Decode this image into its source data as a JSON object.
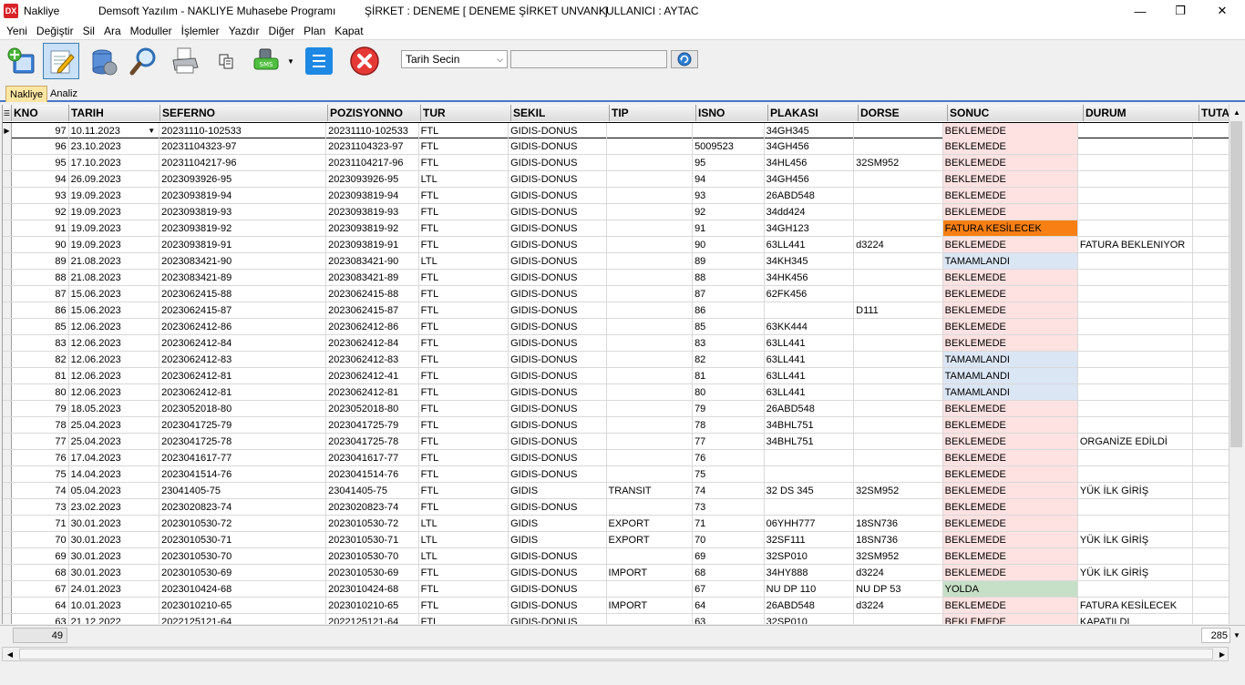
{
  "titlebar": {
    "app_name": "Nakliye",
    "company_name": "Demsoft Yazılım - NAKLIYE Muhasebe Programı",
    "firm": "ŞİRKET : DENEME [ DENEME ŞİRKET UNVANI ]",
    "user": "KULLANICI : AYTAC",
    "minimize": "—",
    "maximize": "❐",
    "close": "✕"
  },
  "menu": [
    "Yeni",
    "Değiştir",
    "Sil",
    "Ara",
    "Moduller",
    "İşlemler",
    "Yazdır",
    "Diğer",
    "Plan",
    "Kapat"
  ],
  "toolbar": {
    "date_select_value": "Tarih Secin",
    "filter_value": ""
  },
  "tabs": [
    "Nakliye",
    "Analiz"
  ],
  "grid": {
    "columns": [
      "KNO",
      "TARIH",
      "SEFERNO",
      "POZISYONNO",
      "TUR",
      "SEKIL",
      "TIP",
      "ISNO",
      "PLAKASI",
      "DORSE",
      "SONUC",
      "DURUM",
      "TUTA"
    ],
    "rows": [
      [
        "97",
        "10.11.2023",
        "20231110-102533",
        "20231110-102533",
        "FTL",
        "GIDIS-DONUS",
        "",
        "",
        "34GH345",
        "",
        "BEKLEMEDE",
        ""
      ],
      [
        "96",
        "23.10.2023",
        "20231104323-97",
        "20231104323-97",
        "FTL",
        "GIDIS-DONUS",
        "",
        "5009523",
        "34GH456",
        "",
        "BEKLEMEDE",
        ""
      ],
      [
        "95",
        "17.10.2023",
        "20231104217-96",
        "20231104217-96",
        "FTL",
        "GIDIS-DONUS",
        "",
        "95",
        "34HL456",
        "32SM952",
        "BEKLEMEDE",
        ""
      ],
      [
        "94",
        "26.09.2023",
        "2023093926-95",
        "2023093926-95",
        "LTL",
        "GIDIS-DONUS",
        "",
        "94",
        "34GH456",
        "",
        "BEKLEMEDE",
        ""
      ],
      [
        "93",
        "19.09.2023",
        "2023093819-94",
        "2023093819-94",
        "FTL",
        "GIDIS-DONUS",
        "",
        "93",
        "26ABD548",
        "",
        "BEKLEMEDE",
        ""
      ],
      [
        "92",
        "19.09.2023",
        "2023093819-93",
        "2023093819-93",
        "FTL",
        "GIDIS-DONUS",
        "",
        "92",
        "34dd424",
        "",
        "BEKLEMEDE",
        ""
      ],
      [
        "91",
        "19.09.2023",
        "2023093819-92",
        "2023093819-92",
        "FTL",
        "GIDIS-DONUS",
        "",
        "91",
        "34GH123",
        "",
        "FATURA KESİLECEK",
        ""
      ],
      [
        "90",
        "19.09.2023",
        "2023093819-91",
        "2023093819-91",
        "FTL",
        "GIDIS-DONUS",
        "",
        "90",
        "63LL441",
        "d3224",
        "BEKLEMEDE",
        "FATURA BEKLENIYOR"
      ],
      [
        "89",
        "21.08.2023",
        "2023083421-90",
        "2023083421-90",
        "LTL",
        "GIDIS-DONUS",
        "",
        "89",
        "34KH345",
        "",
        "TAMAMLANDI",
        ""
      ],
      [
        "88",
        "21.08.2023",
        "2023083421-89",
        "2023083421-89",
        "FTL",
        "GIDIS-DONUS",
        "",
        "88",
        "34HK456",
        "",
        "BEKLEMEDE",
        ""
      ],
      [
        "87",
        "15.06.2023",
        "2023062415-88",
        "2023062415-88",
        "FTL",
        "GIDIS-DONUS",
        "",
        "87",
        "62FK456",
        "",
        "BEKLEMEDE",
        ""
      ],
      [
        "86",
        "15.06.2023",
        "2023062415-87",
        "2023062415-87",
        "FTL",
        "GIDIS-DONUS",
        "",
        "86",
        "",
        "D111",
        "BEKLEMEDE",
        ""
      ],
      [
        "85",
        "12.06.2023",
        "2023062412-86",
        "2023062412-86",
        "FTL",
        "GIDIS-DONUS",
        "",
        "85",
        "63KK444",
        "",
        "BEKLEMEDE",
        ""
      ],
      [
        "83",
        "12.06.2023",
        "2023062412-84",
        "2023062412-84",
        "FTL",
        "GIDIS-DONUS",
        "",
        "83",
        "63LL441",
        "",
        "BEKLEMEDE",
        ""
      ],
      [
        "82",
        "12.06.2023",
        "2023062412-83",
        "2023062412-83",
        "FTL",
        "GIDIS-DONUS",
        "",
        "82",
        "63LL441",
        "",
        "TAMAMLANDI",
        ""
      ],
      [
        "81",
        "12.06.2023",
        "2023062412-81",
        "2023062412-41",
        "FTL",
        "GIDIS-DONUS",
        "",
        "81",
        "63LL441",
        "",
        "TAMAMLANDI",
        ""
      ],
      [
        "80",
        "12.06.2023",
        "2023062412-81",
        "2023062412-81",
        "FTL",
        "GIDIS-DONUS",
        "",
        "80",
        "63LL441",
        "",
        "TAMAMLANDI",
        ""
      ],
      [
        "79",
        "18.05.2023",
        "2023052018-80",
        "2023052018-80",
        "FTL",
        "GIDIS-DONUS",
        "",
        "79",
        "26ABD548",
        "",
        "BEKLEMEDE",
        ""
      ],
      [
        "78",
        "25.04.2023",
        "2023041725-79",
        "2023041725-79",
        "FTL",
        "GIDIS-DONUS",
        "",
        "78",
        "34BHL751",
        "",
        "BEKLEMEDE",
        ""
      ],
      [
        "77",
        "25.04.2023",
        "2023041725-78",
        "2023041725-78",
        "FTL",
        "GIDIS-DONUS",
        "",
        "77",
        "34BHL751",
        "",
        "BEKLEMEDE",
        "ORGANİZE EDİLDİ"
      ],
      [
        "76",
        "17.04.2023",
        "2023041617-77",
        "2023041617-77",
        "FTL",
        "GIDIS-DONUS",
        "",
        "76",
        "",
        "",
        "BEKLEMEDE",
        ""
      ],
      [
        "75",
        "14.04.2023",
        "2023041514-76",
        "2023041514-76",
        "FTL",
        "GIDIS-DONUS",
        "",
        "75",
        "",
        "",
        "BEKLEMEDE",
        ""
      ],
      [
        "74",
        "05.04.2023",
        "23041405-75",
        "23041405-75",
        "FTL",
        "GIDIS",
        "TRANSIT",
        "74",
        "32 DS 345",
        "32SM952",
        "BEKLEMEDE",
        "YÜK İLK GİRİŞ"
      ],
      [
        "73",
        "23.02.2023",
        "2023020823-74",
        "2023020823-74",
        "FTL",
        "GIDIS-DONUS",
        "",
        "73",
        "",
        "",
        "BEKLEMEDE",
        ""
      ],
      [
        "71",
        "30.01.2023",
        "2023010530-72",
        "2023010530-72",
        "LTL",
        "GIDIS",
        "EXPORT",
        "71",
        "06YHH777",
        "18SN736",
        "BEKLEMEDE",
        ""
      ],
      [
        "70",
        "30.01.2023",
        "2023010530-71",
        "2023010530-71",
        "LTL",
        "GIDIS",
        "EXPORT",
        "70",
        "32SF111",
        "18SN736",
        "BEKLEMEDE",
        "YÜK İLK GİRİŞ"
      ],
      [
        "69",
        "30.01.2023",
        "2023010530-70",
        "2023010530-70",
        "LTL",
        "GIDIS-DONUS",
        "",
        "69",
        "32SP010",
        "32SM952",
        "BEKLEMEDE",
        ""
      ],
      [
        "68",
        "30.01.2023",
        "2023010530-69",
        "2023010530-69",
        "FTL",
        "GIDIS-DONUS",
        "IMPORT",
        "68",
        "34HY888",
        "d3224",
        "BEKLEMEDE",
        "YÜK İLK GİRİŞ"
      ],
      [
        "67",
        "24.01.2023",
        "2023010424-68",
        "2023010424-68",
        "FTL",
        "GIDIS-DONUS",
        "",
        "67",
        "NU DP 110",
        "NU DP 53",
        "YOLDA",
        ""
      ],
      [
        "64",
        "10.01.2023",
        "2023010210-65",
        "2023010210-65",
        "FTL",
        "GIDIS-DONUS",
        "IMPORT",
        "64",
        "26ABD548",
        "d3224",
        "BEKLEMEDE",
        "FATURA KESİLECEK"
      ],
      [
        "63",
        "21.12.2022",
        "2022125121-64",
        "2022125121-64",
        "FTL",
        "GIDIS-DONUS",
        "",
        "63",
        "32SP010",
        "",
        "BEKLEMEDE",
        "KAPATILDI"
      ]
    ]
  },
  "footer": {
    "record_count": "49",
    "total": "285"
  },
  "icons": {
    "new": "new-record-icon",
    "edit": "edit-icon",
    "delete": "delete-icon",
    "search": "search-icon",
    "print": "print-icon",
    "copy": "copy-icon",
    "sms": "sms-icon",
    "list": "list-icon",
    "close": "close-icon"
  },
  "colors": {
    "status_waiting": "#fde2e1",
    "status_invoice": "#f77f14",
    "status_done": "#dbe6f4",
    "status_onroad": "#c6e0c7",
    "tab_active": "#ffe7a3",
    "tab_border": "#4a78c8"
  }
}
